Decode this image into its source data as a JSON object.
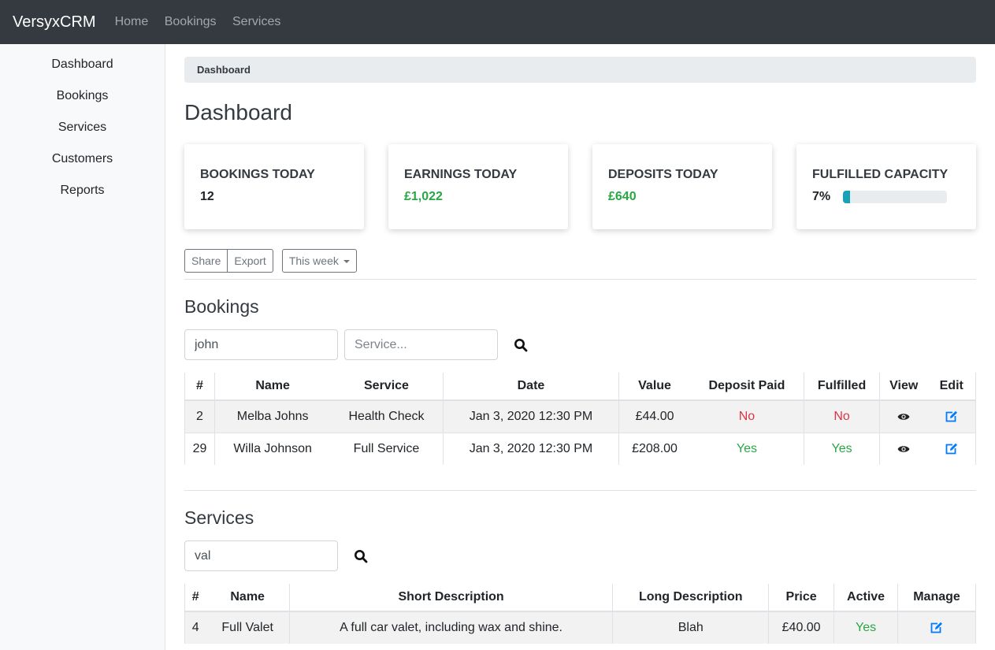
{
  "nav": {
    "brand": "VersyxCRM",
    "links": [
      "Home",
      "Bookings",
      "Services"
    ]
  },
  "sidebar": {
    "items": [
      "Dashboard",
      "Bookings",
      "Services",
      "Customers",
      "Reports"
    ]
  },
  "breadcrumb": "Dashboard",
  "page_title": "Dashboard",
  "stats": {
    "bookings_today": {
      "label": "BOOKINGS TODAY",
      "value": "12"
    },
    "earnings_today": {
      "label": "EARNINGS TODAY",
      "value": "£1,022"
    },
    "deposits_today": {
      "label": "DEPOSITS TODAY",
      "value": "£640"
    },
    "fulfilled_capacity": {
      "label": "FULFILLED CAPACITY",
      "value": "7%",
      "fraction": 0.07
    }
  },
  "toolbar": {
    "share_label": "Share",
    "export_label": "Export",
    "period_label": "This week"
  },
  "bookings": {
    "heading": "Bookings",
    "name_filter_value": "john",
    "service_filter_placeholder": "Service...",
    "columns": [
      "#",
      "Name",
      "Service",
      "Date",
      "Value",
      "Deposit Paid",
      "Fulfilled",
      "View",
      "Edit"
    ],
    "rows": [
      {
        "id": "2",
        "name": "Melba Johns",
        "service": "Health Check",
        "date": "Jan 3, 2020 12:30 PM",
        "value": "£44.00",
        "deposit_paid": "No",
        "fulfilled": "No"
      },
      {
        "id": "29",
        "name": "Willa Johnson",
        "service": "Full Service",
        "date": "Jan 3, 2020 12:30 PM",
        "value": "£208.00",
        "deposit_paid": "Yes",
        "fulfilled": "Yes"
      }
    ]
  },
  "services": {
    "heading": "Services",
    "filter_value": "val",
    "columns": [
      "#",
      "Name",
      "Short Description",
      "Long Description",
      "Price",
      "Active",
      "Manage"
    ],
    "rows": [
      {
        "id": "4",
        "name": "Full Valet",
        "short_description": "A full car valet, including wax and shine.",
        "long_description": "Blah",
        "price": "£40.00",
        "active": "Yes"
      }
    ]
  },
  "colors": {
    "navbar": "#343a40",
    "success": "#28a745",
    "danger": "#dc3545",
    "primary": "#007bff",
    "progress": "#17a2b8"
  }
}
